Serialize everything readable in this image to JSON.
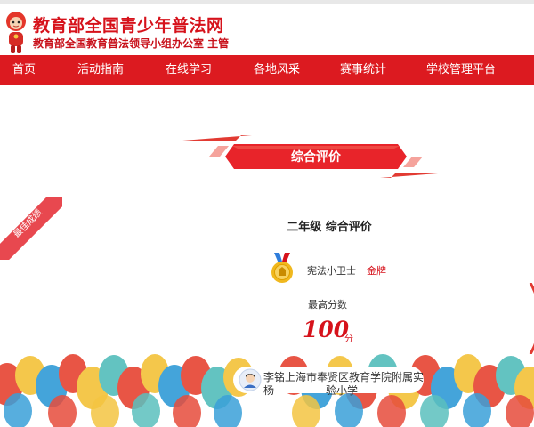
{
  "site": {
    "title": "教育部全国青少年普法网",
    "subtitle": "教育部全国教育普法领导小组办公室 主管"
  },
  "nav": {
    "items": [
      "首页",
      "活动指南",
      "在线学习",
      "各地风采",
      "赛事统计",
      "学校管理平台"
    ]
  },
  "banner": {
    "label": "综合评价"
  },
  "ribbon": {
    "label": "最佳成绩"
  },
  "result": {
    "grade_title": "二年级 综合评价",
    "achievement_name": "宪法小卫士",
    "achievement_level": "金牌",
    "best_score_label": "最高分数",
    "score": "100",
    "score_unit": "分",
    "student_name": "杨",
    "school_name_part1": "上海市奉贤区教育学院附属实",
    "school_name_part2": "验小学",
    "name_prefix": "李铭"
  },
  "colors": {
    "brand_red": "#dc1a20",
    "title_red": "#d6121b",
    "medal_gold": "#f0b81e"
  },
  "icons": {
    "medal": "gold-medal-icon",
    "school_avatar": "student-avatar-icon"
  }
}
